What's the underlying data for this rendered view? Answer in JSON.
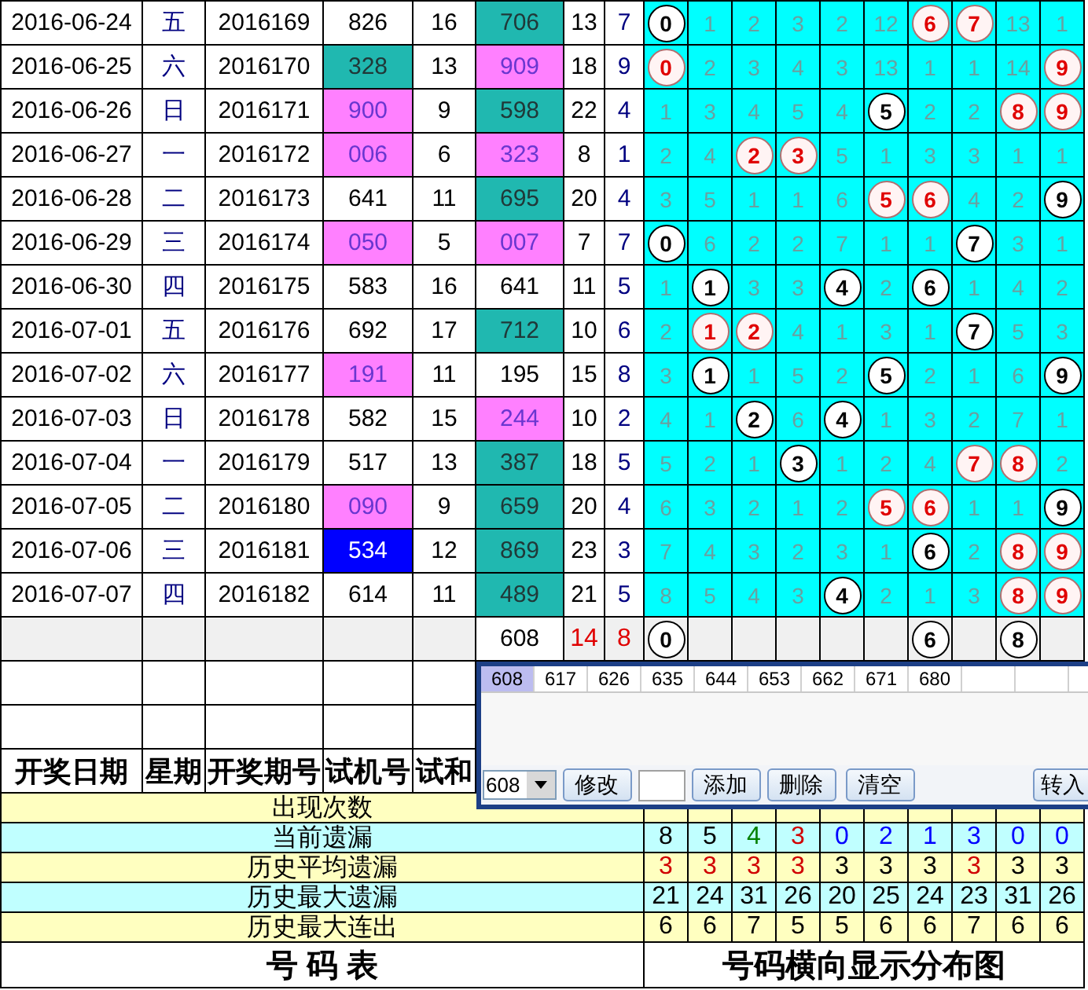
{
  "rows": [
    {
      "date": "2016-06-24",
      "weekday": "五",
      "period": "2016169",
      "trial": {
        "text": "826",
        "color": "#ffffff"
      },
      "trial_sum": "16",
      "draw": {
        "text": "706",
        "color": "#20b8b0"
      },
      "sum": "13",
      "span": "7",
      "cells": [
        {
          "kind": "ball",
          "text": "0",
          "highlight": false
        },
        {
          "kind": "miss",
          "text": "1"
        },
        {
          "kind": "miss",
          "text": "2"
        },
        {
          "kind": "miss",
          "text": "3"
        },
        {
          "kind": "miss",
          "text": "2"
        },
        {
          "kind": "miss",
          "text": "12"
        },
        {
          "kind": "ball",
          "text": "6",
          "highlight": true
        },
        {
          "kind": "ball",
          "text": "7",
          "highlight": true
        },
        {
          "kind": "miss",
          "text": "13"
        },
        {
          "kind": "miss",
          "text": "1"
        }
      ]
    },
    {
      "date": "2016-06-25",
      "weekday": "六",
      "period": "2016170",
      "trial": {
        "text": "328",
        "color": "#20b8b0"
      },
      "trial_sum": "13",
      "draw": {
        "text": "909",
        "color": "#ff80ff"
      },
      "sum": "18",
      "span": "9",
      "cells": [
        {
          "kind": "ball",
          "text": "0",
          "highlight": true
        },
        {
          "kind": "miss",
          "text": "2"
        },
        {
          "kind": "miss",
          "text": "3"
        },
        {
          "kind": "miss",
          "text": "4"
        },
        {
          "kind": "miss",
          "text": "3"
        },
        {
          "kind": "miss",
          "text": "13"
        },
        {
          "kind": "miss",
          "text": "1"
        },
        {
          "kind": "miss",
          "text": "1"
        },
        {
          "kind": "miss",
          "text": "14"
        },
        {
          "kind": "ball",
          "text": "9",
          "highlight": true
        }
      ]
    },
    {
      "date": "2016-06-26",
      "weekday": "日",
      "period": "2016171",
      "trial": {
        "text": "900",
        "color": "#ff80ff"
      },
      "trial_sum": "9",
      "draw": {
        "text": "598",
        "color": "#20b8b0"
      },
      "sum": "22",
      "span": "4",
      "cells": [
        {
          "kind": "miss",
          "text": "1"
        },
        {
          "kind": "miss",
          "text": "3"
        },
        {
          "kind": "miss",
          "text": "4"
        },
        {
          "kind": "miss",
          "text": "5"
        },
        {
          "kind": "miss",
          "text": "4"
        },
        {
          "kind": "ball",
          "text": "5",
          "highlight": false
        },
        {
          "kind": "miss",
          "text": "2"
        },
        {
          "kind": "miss",
          "text": "2"
        },
        {
          "kind": "ball",
          "text": "8",
          "highlight": true
        },
        {
          "kind": "ball",
          "text": "9",
          "highlight": true
        }
      ]
    },
    {
      "date": "2016-06-27",
      "weekday": "一",
      "period": "2016172",
      "trial": {
        "text": "006",
        "color": "#ff80ff"
      },
      "trial_sum": "6",
      "draw": {
        "text": "323",
        "color": "#ff80ff"
      },
      "sum": "8",
      "span": "1",
      "cells": [
        {
          "kind": "miss",
          "text": "2"
        },
        {
          "kind": "miss",
          "text": "4"
        },
        {
          "kind": "ball",
          "text": "2",
          "highlight": true
        },
        {
          "kind": "ball",
          "text": "3",
          "highlight": true
        },
        {
          "kind": "miss",
          "text": "5"
        },
        {
          "kind": "miss",
          "text": "1"
        },
        {
          "kind": "miss",
          "text": "3"
        },
        {
          "kind": "miss",
          "text": "3"
        },
        {
          "kind": "miss",
          "text": "1"
        },
        {
          "kind": "miss",
          "text": "1"
        }
      ]
    },
    {
      "date": "2016-06-28",
      "weekday": "二",
      "period": "2016173",
      "trial": {
        "text": "641",
        "color": "#ffffff"
      },
      "trial_sum": "11",
      "draw": {
        "text": "695",
        "color": "#20b8b0"
      },
      "sum": "20",
      "span": "4",
      "cells": [
        {
          "kind": "miss",
          "text": "3"
        },
        {
          "kind": "miss",
          "text": "5"
        },
        {
          "kind": "miss",
          "text": "1"
        },
        {
          "kind": "miss",
          "text": "1"
        },
        {
          "kind": "miss",
          "text": "6"
        },
        {
          "kind": "ball",
          "text": "5",
          "highlight": true
        },
        {
          "kind": "ball",
          "text": "6",
          "highlight": true
        },
        {
          "kind": "miss",
          "text": "4"
        },
        {
          "kind": "miss",
          "text": "2"
        },
        {
          "kind": "ball",
          "text": "9",
          "highlight": false
        }
      ]
    },
    {
      "date": "2016-06-29",
      "weekday": "三",
      "period": "2016174",
      "trial": {
        "text": "050",
        "color": "#ff80ff"
      },
      "trial_sum": "5",
      "draw": {
        "text": "007",
        "color": "#ff80ff"
      },
      "sum": "7",
      "span": "7",
      "cells": [
        {
          "kind": "ball",
          "text": "0",
          "highlight": false
        },
        {
          "kind": "miss",
          "text": "6"
        },
        {
          "kind": "miss",
          "text": "2"
        },
        {
          "kind": "miss",
          "text": "2"
        },
        {
          "kind": "miss",
          "text": "7"
        },
        {
          "kind": "miss",
          "text": "1"
        },
        {
          "kind": "miss",
          "text": "1"
        },
        {
          "kind": "ball",
          "text": "7",
          "highlight": false
        },
        {
          "kind": "miss",
          "text": "3"
        },
        {
          "kind": "miss",
          "text": "1"
        }
      ]
    },
    {
      "date": "2016-06-30",
      "weekday": "四",
      "period": "2016175",
      "trial": {
        "text": "583",
        "color": "#ffffff"
      },
      "trial_sum": "16",
      "draw": {
        "text": "641",
        "color": "#ffffff"
      },
      "sum": "11",
      "span": "5",
      "cells": [
        {
          "kind": "miss",
          "text": "1"
        },
        {
          "kind": "ball",
          "text": "1",
          "highlight": false
        },
        {
          "kind": "miss",
          "text": "3"
        },
        {
          "kind": "miss",
          "text": "3"
        },
        {
          "kind": "ball",
          "text": "4",
          "highlight": false
        },
        {
          "kind": "miss",
          "text": "2"
        },
        {
          "kind": "ball",
          "text": "6",
          "highlight": false
        },
        {
          "kind": "miss",
          "text": "1"
        },
        {
          "kind": "miss",
          "text": "4"
        },
        {
          "kind": "miss",
          "text": "2"
        }
      ]
    },
    {
      "date": "2016-07-01",
      "weekday": "五",
      "period": "2016176",
      "trial": {
        "text": "692",
        "color": "#ffffff"
      },
      "trial_sum": "17",
      "draw": {
        "text": "712",
        "color": "#20b8b0"
      },
      "sum": "10",
      "span": "6",
      "cells": [
        {
          "kind": "miss",
          "text": "2"
        },
        {
          "kind": "ball",
          "text": "1",
          "highlight": true
        },
        {
          "kind": "ball",
          "text": "2",
          "highlight": true
        },
        {
          "kind": "miss",
          "text": "4"
        },
        {
          "kind": "miss",
          "text": "1"
        },
        {
          "kind": "miss",
          "text": "3"
        },
        {
          "kind": "miss",
          "text": "1"
        },
        {
          "kind": "ball",
          "text": "7",
          "highlight": false
        },
        {
          "kind": "miss",
          "text": "5"
        },
        {
          "kind": "miss",
          "text": "3"
        }
      ]
    },
    {
      "date": "2016-07-02",
      "weekday": "六",
      "period": "2016177",
      "trial": {
        "text": "191",
        "color": "#ff80ff"
      },
      "trial_sum": "11",
      "draw": {
        "text": "195",
        "color": "#ffffff"
      },
      "sum": "15",
      "span": "8",
      "cells": [
        {
          "kind": "miss",
          "text": "3"
        },
        {
          "kind": "ball",
          "text": "1",
          "highlight": false
        },
        {
          "kind": "miss",
          "text": "1"
        },
        {
          "kind": "miss",
          "text": "5"
        },
        {
          "kind": "miss",
          "text": "2"
        },
        {
          "kind": "ball",
          "text": "5",
          "highlight": false
        },
        {
          "kind": "miss",
          "text": "2"
        },
        {
          "kind": "miss",
          "text": "1"
        },
        {
          "kind": "miss",
          "text": "6"
        },
        {
          "kind": "ball",
          "text": "9",
          "highlight": false
        }
      ]
    },
    {
      "date": "2016-07-03",
      "weekday": "日",
      "period": "2016178",
      "trial": {
        "text": "582",
        "color": "#ffffff"
      },
      "trial_sum": "15",
      "draw": {
        "text": "244",
        "color": "#ff80ff"
      },
      "sum": "10",
      "span": "2",
      "cells": [
        {
          "kind": "miss",
          "text": "4"
        },
        {
          "kind": "miss",
          "text": "1"
        },
        {
          "kind": "ball",
          "text": "2",
          "highlight": false
        },
        {
          "kind": "miss",
          "text": "6"
        },
        {
          "kind": "ball",
          "text": "4",
          "highlight": false
        },
        {
          "kind": "miss",
          "text": "1"
        },
        {
          "kind": "miss",
          "text": "3"
        },
        {
          "kind": "miss",
          "text": "2"
        },
        {
          "kind": "miss",
          "text": "7"
        },
        {
          "kind": "miss",
          "text": "1"
        }
      ]
    },
    {
      "date": "2016-07-04",
      "weekday": "一",
      "period": "2016179",
      "trial": {
        "text": "517",
        "color": "#ffffff"
      },
      "trial_sum": "13",
      "draw": {
        "text": "387",
        "color": "#20b8b0"
      },
      "sum": "18",
      "span": "5",
      "cells": [
        {
          "kind": "miss",
          "text": "5"
        },
        {
          "kind": "miss",
          "text": "2"
        },
        {
          "kind": "miss",
          "text": "1"
        },
        {
          "kind": "ball",
          "text": "3",
          "highlight": false
        },
        {
          "kind": "miss",
          "text": "1"
        },
        {
          "kind": "miss",
          "text": "2"
        },
        {
          "kind": "miss",
          "text": "4"
        },
        {
          "kind": "ball",
          "text": "7",
          "highlight": true
        },
        {
          "kind": "ball",
          "text": "8",
          "highlight": true
        },
        {
          "kind": "miss",
          "text": "2"
        }
      ]
    },
    {
      "date": "2016-07-05",
      "weekday": "二",
      "period": "2016180",
      "trial": {
        "text": "090",
        "color": "#ff80ff"
      },
      "trial_sum": "9",
      "draw": {
        "text": "659",
        "color": "#20b8b0"
      },
      "sum": "20",
      "span": "4",
      "cells": [
        {
          "kind": "miss",
          "text": "6"
        },
        {
          "kind": "miss",
          "text": "3"
        },
        {
          "kind": "miss",
          "text": "2"
        },
        {
          "kind": "miss",
          "text": "1"
        },
        {
          "kind": "miss",
          "text": "2"
        },
        {
          "kind": "ball",
          "text": "5",
          "highlight": true
        },
        {
          "kind": "ball",
          "text": "6",
          "highlight": true
        },
        {
          "kind": "miss",
          "text": "1"
        },
        {
          "kind": "miss",
          "text": "1"
        },
        {
          "kind": "ball",
          "text": "9",
          "highlight": false
        }
      ]
    },
    {
      "date": "2016-07-06",
      "weekday": "三",
      "period": "2016181",
      "trial": {
        "text": "534",
        "color": "#0000ff"
      },
      "trial_sum": "12",
      "draw": {
        "text": "869",
        "color": "#20b8b0"
      },
      "sum": "23",
      "span": "3",
      "cells": [
        {
          "kind": "miss",
          "text": "7"
        },
        {
          "kind": "miss",
          "text": "4"
        },
        {
          "kind": "miss",
          "text": "3"
        },
        {
          "kind": "miss",
          "text": "2"
        },
        {
          "kind": "miss",
          "text": "3"
        },
        {
          "kind": "miss",
          "text": "1"
        },
        {
          "kind": "ball",
          "text": "6",
          "highlight": false
        },
        {
          "kind": "miss",
          "text": "2"
        },
        {
          "kind": "ball",
          "text": "8",
          "highlight": true
        },
        {
          "kind": "ball",
          "text": "9",
          "highlight": true
        }
      ]
    },
    {
      "date": "2016-07-07",
      "weekday": "四",
      "period": "2016182",
      "trial": {
        "text": "614",
        "color": "#ffffff"
      },
      "trial_sum": "11",
      "draw": {
        "text": "489",
        "color": "#20b8b0"
      },
      "sum": "21",
      "span": "5",
      "cells": [
        {
          "kind": "miss",
          "text": "8"
        },
        {
          "kind": "miss",
          "text": "5"
        },
        {
          "kind": "miss",
          "text": "4"
        },
        {
          "kind": "miss",
          "text": "3"
        },
        {
          "kind": "ball",
          "text": "4",
          "highlight": false
        },
        {
          "kind": "miss",
          "text": "2"
        },
        {
          "kind": "miss",
          "text": "1"
        },
        {
          "kind": "miss",
          "text": "3"
        },
        {
          "kind": "ball",
          "text": "8",
          "highlight": true
        },
        {
          "kind": "ball",
          "text": "9",
          "highlight": true
        }
      ]
    }
  ],
  "summary": {
    "draw": "608",
    "sum": "14",
    "span": "8",
    "cells": [
      {
        "kind": "ball",
        "text": "0",
        "highlight": false
      },
      {
        "kind": "blank"
      },
      {
        "kind": "blank"
      },
      {
        "kind": "blank"
      },
      {
        "kind": "blank"
      },
      {
        "kind": "blank"
      },
      {
        "kind": "ball",
        "text": "6",
        "highlight": false
      },
      {
        "kind": "blank"
      },
      {
        "kind": "ball",
        "text": "8",
        "highlight": false
      },
      {
        "kind": "blank"
      }
    ]
  },
  "header": [
    "开奖日期",
    "星期",
    "开奖期号",
    "试机号",
    "试和"
  ],
  "stats": [
    {
      "label": "出现次数"
    },
    {
      "label": "当前遗漏",
      "values": [
        {
          "text": "8",
          "color": "#000000"
        },
        {
          "text": "5",
          "color": "#000000"
        },
        {
          "text": "4",
          "color": "#008000"
        },
        {
          "text": "3",
          "color": "#d00000"
        },
        {
          "text": "0",
          "color": "#0000ff"
        },
        {
          "text": "2",
          "color": "#0000ff"
        },
        {
          "text": "1",
          "color": "#0000ff"
        },
        {
          "text": "3",
          "color": "#0000ff"
        },
        {
          "text": "0",
          "color": "#0000ff"
        },
        {
          "text": "0",
          "color": "#0000ff"
        }
      ]
    },
    {
      "label": "历史平均遗漏",
      "values": [
        {
          "text": "3",
          "color": "#d00000"
        },
        {
          "text": "3",
          "color": "#d00000"
        },
        {
          "text": "3",
          "color": "#d00000"
        },
        {
          "text": "3",
          "color": "#d00000"
        },
        {
          "text": "3",
          "color": "#000000"
        },
        {
          "text": "3",
          "color": "#000000"
        },
        {
          "text": "3",
          "color": "#000000"
        },
        {
          "text": "3",
          "color": "#d00000"
        },
        {
          "text": "3",
          "color": "#000000"
        },
        {
          "text": "3",
          "color": "#000000"
        }
      ]
    },
    {
      "label": "历史最大遗漏",
      "values": [
        {
          "text": "21",
          "color": "#000000"
        },
        {
          "text": "24",
          "color": "#000000"
        },
        {
          "text": "31",
          "color": "#000000"
        },
        {
          "text": "26",
          "color": "#000000"
        },
        {
          "text": "20",
          "color": "#000000"
        },
        {
          "text": "25",
          "color": "#000000"
        },
        {
          "text": "24",
          "color": "#000000"
        },
        {
          "text": "23",
          "color": "#000000"
        },
        {
          "text": "31",
          "color": "#000000"
        },
        {
          "text": "26",
          "color": "#000000"
        }
      ]
    },
    {
      "label": "历史最大连出",
      "values": [
        {
          "text": "6",
          "color": "#000000"
        },
        {
          "text": "6",
          "color": "#000000"
        },
        {
          "text": "7",
          "color": "#000000"
        },
        {
          "text": "5",
          "color": "#000000"
        },
        {
          "text": "5",
          "color": "#000000"
        },
        {
          "text": "6",
          "color": "#000000"
        },
        {
          "text": "6",
          "color": "#000000"
        },
        {
          "text": "7",
          "color": "#000000"
        },
        {
          "text": "6",
          "color": "#000000"
        },
        {
          "text": "6",
          "color": "#000000"
        }
      ]
    }
  ],
  "footer": {
    "left": "号 码 表",
    "right": "号码横向显示分布图"
  },
  "popup": {
    "items": [
      {
        "text": "608",
        "selected": true
      },
      {
        "text": "617",
        "selected": false
      },
      {
        "text": "626",
        "selected": false
      },
      {
        "text": "635",
        "selected": false
      },
      {
        "text": "644",
        "selected": false
      },
      {
        "text": "653",
        "selected": false
      },
      {
        "text": "662",
        "selected": false
      },
      {
        "text": "671",
        "selected": false
      },
      {
        "text": "680",
        "selected": false
      }
    ],
    "combo": "608",
    "edit_button": "修改",
    "add_button": "添加",
    "delete_button": "删除",
    "clear_button": "清空",
    "transfer_button": "转入"
  }
}
